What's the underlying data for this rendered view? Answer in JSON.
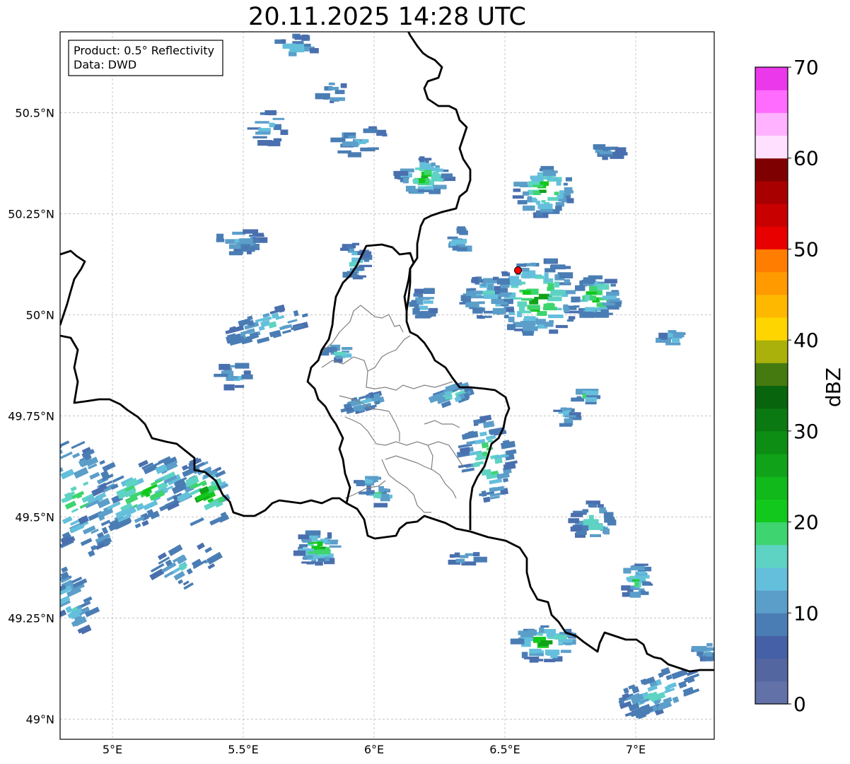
{
  "title": "20.11.2025 14:28 UTC",
  "info_box": {
    "product": "Product: 0.5° Reflectivity",
    "data": "Data: DWD"
  },
  "axes": {
    "lon_ticks": [
      "5°E",
      "5.5°E",
      "6°E",
      "6.5°E",
      "7°E"
    ],
    "lat_ticks": [
      "49°N",
      "49.25°N",
      "49.5°N",
      "49.75°N",
      "50°N",
      "50.25°N",
      "50.5°N"
    ],
    "lon_values": [
      5.0,
      5.5,
      6.0,
      6.5,
      7.0
    ],
    "lat_values": [
      49.0,
      49.25,
      49.5,
      49.75,
      50.0,
      50.25,
      50.5
    ],
    "lon_range": [
      4.8,
      7.3
    ],
    "lat_range": [
      48.95,
      50.7
    ],
    "grid": "dashed"
  },
  "radar_site": {
    "lon": 6.55,
    "lat": 50.11,
    "color": "#ff0000"
  },
  "colorbar": {
    "label": "dBZ",
    "ticks": [
      "0",
      "10",
      "20",
      "30",
      "40",
      "50",
      "60",
      "70"
    ],
    "min": 0,
    "max": 70,
    "colors": [
      "#6272a8",
      "#5466a0",
      "#4560a6",
      "#4a7db4",
      "#5b9ec9",
      "#64bfdc",
      "#5ed3c3",
      "#3ed46f",
      "#12c81c",
      "#11b91b",
      "#10a218",
      "#0e8d14",
      "#0b7911",
      "#08640d",
      "#457a10",
      "#a9b10a",
      "#ffd500",
      "#ffb800",
      "#ff9a00",
      "#ff7d00",
      "#e80000",
      "#c80000",
      "#a80000",
      "#7f0000",
      "#ffe1ff",
      "#ffb2ff",
      "#ff6cff",
      "#ea38ea"
    ]
  }
}
